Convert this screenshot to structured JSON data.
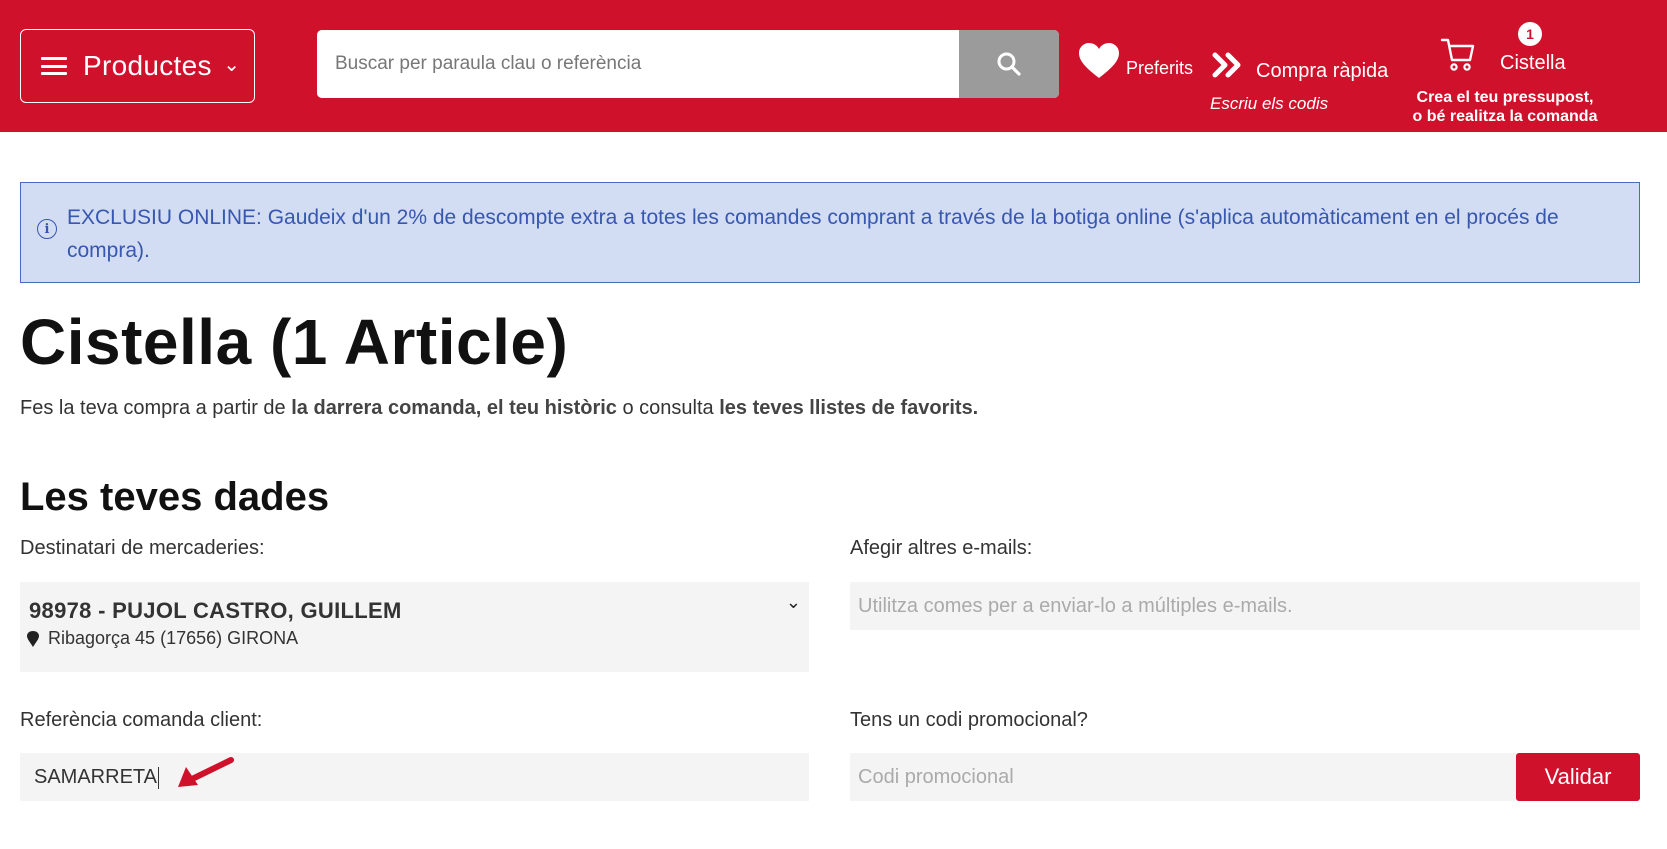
{
  "header": {
    "products_label": "Productes",
    "search_placeholder": "Buscar per paraula clau o referència",
    "favorites_label": "Preferits",
    "quick_buy_label": "Compra ràpida",
    "quick_buy_sub": "Escriu els codis",
    "cart_count": "1",
    "cart_label": "Cistella",
    "cart_sub_line1": "Crea el teu pressupost,",
    "cart_sub_line2": "o bé realitza la comanda"
  },
  "banner": {
    "text": "EXCLUSIU ONLINE: Gaudeix d'un 2% de descompte extra a totes les comandes comprant a través de la botiga online (s'aplica automàticament en el procés de compra)."
  },
  "page": {
    "title": "Cistella (1 Article)",
    "sub_prefix": "Fes la teva compra a partir de ",
    "sub_link1": "la darrera comanda, el teu històric",
    "sub_middle": " o consulta ",
    "sub_link2": "les teves llistes de favorits."
  },
  "section": {
    "title": "Les teves dades"
  },
  "form": {
    "recipient_label": "Destinatari de mercaderies:",
    "recipient_name": "98978 - PUJOL CASTRO, GUILLEM",
    "recipient_address": "Ribagorça 45 (17656) GIRONA",
    "emails_label": "Afegir altres e-mails:",
    "emails_placeholder": "Utilitza comes per a enviar-lo a múltiples e-mails.",
    "order_ref_label": "Referència comanda client:",
    "order_ref_value": "SAMARRETA",
    "promo_label": "Tens un codi promocional?",
    "promo_placeholder": "Codi promocional",
    "validate_label": "Validar"
  },
  "colors": {
    "brand": "#d0112b",
    "banner_bg": "#d2dcf2",
    "banner_text": "#3757b0",
    "field_bg": "#f4f4f4"
  },
  "icons": [
    "menu-icon",
    "chevron-down-icon",
    "search-icon",
    "heart-icon",
    "double-chevron-icon",
    "cart-icon",
    "info-icon",
    "map-pin-icon",
    "arrow-icon"
  ]
}
